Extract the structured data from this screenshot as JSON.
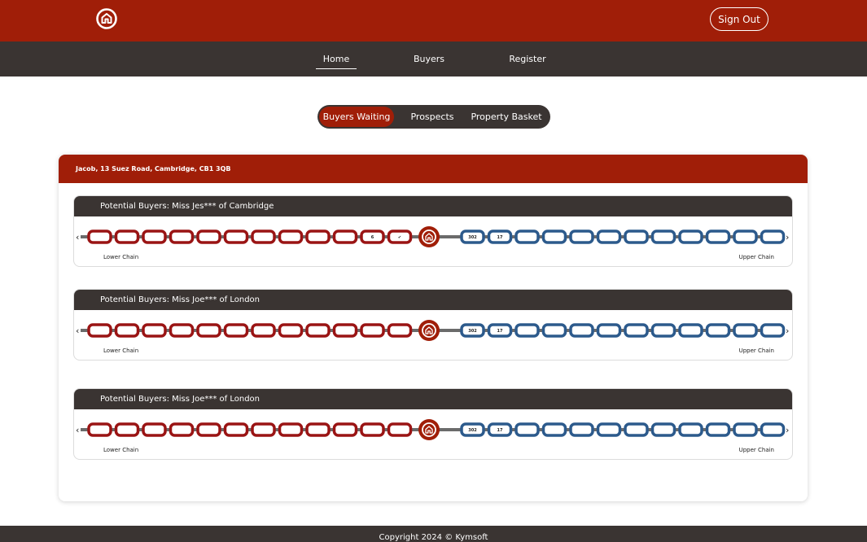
{
  "header": {
    "logo_icon": "house-ring-icon",
    "signout_label": "Sign Out",
    "colors": {
      "brand": "#a01e08",
      "dark": "#3a3432"
    }
  },
  "nav": {
    "items": [
      {
        "label": "Home",
        "active": true
      },
      {
        "label": "Buyers",
        "active": false
      },
      {
        "label": "Register",
        "active": false
      }
    ]
  },
  "tabs": [
    {
      "label": "Buyers Waiting",
      "active": true
    },
    {
      "label": "Prospects",
      "active": false
    },
    {
      "label": "Property Basket",
      "active": false
    }
  ],
  "property": {
    "title": "Jacob, 13 Suez Road, Cambridge, CB1 3QB"
  },
  "buyers": [
    {
      "title": "Potential Buyers: Miss Jes*** of Cambridge",
      "lower_links": [
        "",
        "",
        "",
        "",
        "",
        "",
        "",
        "",
        "",
        "",
        "6",
        "✔"
      ],
      "upper_links": [
        "302",
        "17",
        "",
        "",
        "",
        "",
        "",
        "",
        "",
        "",
        "",
        ""
      ],
      "lower_label": "Lower Chain",
      "upper_label": "Upper Chain"
    },
    {
      "title": "Potential Buyers: Miss Joe*** of London",
      "lower_links": [
        "",
        "",
        "",
        "",
        "",
        "",
        "",
        "",
        "",
        "",
        "",
        ""
      ],
      "upper_links": [
        "302",
        "17",
        "",
        "",
        "",
        "",
        "",
        "",
        "",
        "",
        "",
        ""
      ],
      "lower_label": "Lower Chain",
      "upper_label": "Upper Chain"
    },
    {
      "title": "Potential Buyers: Miss Joe*** of London",
      "lower_links": [
        "",
        "",
        "",
        "",
        "",
        "",
        "",
        "",
        "",
        "",
        "",
        ""
      ],
      "upper_links": [
        "302",
        "17",
        "",
        "",
        "",
        "",
        "",
        "",
        "",
        "",
        "",
        ""
      ],
      "lower_label": "Lower Chain",
      "upper_label": "Upper Chain"
    }
  ],
  "chain_colors": {
    "lower": "#9a1414",
    "upper": "#2c5a8c",
    "bar": "#6b6b6b",
    "hub": "#a01e08"
  },
  "footer": {
    "copyright": "Copyright 2024 © Kymsoft"
  }
}
